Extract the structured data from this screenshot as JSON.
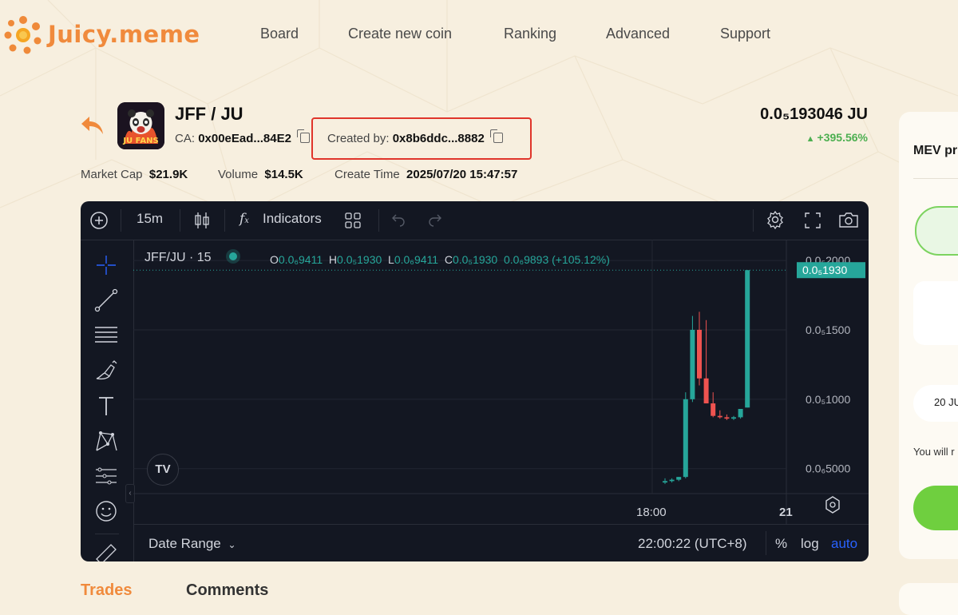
{
  "brand": {
    "name": "Juicy.meme"
  },
  "nav": {
    "items": [
      "Board",
      "Create new coin",
      "Ranking",
      "Advanced",
      "Support"
    ]
  },
  "token": {
    "pair": "JFF / JU",
    "image_text": "JU FANS",
    "ca_label": "CA:",
    "ca_value": "0x00eEad...84E2",
    "created_label": "Created by:",
    "created_value": "0x8b6ddc...8882",
    "price": "0.0₅193046 JU",
    "change": "+395.56%",
    "market_cap_label": "Market Cap",
    "market_cap_value": "$21.9K",
    "volume_label": "Volume",
    "volume_value": "$14.5K",
    "create_time_label": "Create Time",
    "create_time_value": "2025/07/20 15:47:57"
  },
  "chart_toolbar": {
    "interval": "15m",
    "indicators_label": "Indicators"
  },
  "chart": {
    "symbol_title": "JFF/JU · 15",
    "ohlc": {
      "o_label": "O",
      "o_value": "0.0₆9411",
      "h_label": "H",
      "h_value": "0.0₅1930",
      "l_label": "L",
      "l_value": "0.0₆9411",
      "c_label": "C",
      "c_value": "0.0₅1930",
      "change_value": "0.0₆9893 (+105.12%)"
    },
    "last_price_tag": "0.0₅1930",
    "watermark": "TV",
    "date_range_label": "Date Range",
    "clock": "22:00:22 (UTC+8)",
    "pct_label": "%",
    "log_label": "log",
    "auto_label": "auto"
  },
  "chart_data": {
    "type": "candlestick",
    "y_tick_labels": [
      "0.0₅2000",
      "0.0₅1500",
      "0.0₅1000",
      "0.0₆5000"
    ],
    "y_tick_values": [
      2e-05,
      1.5e-05,
      1e-05,
      5e-06
    ],
    "x_tick_labels": [
      "18:00",
      "21"
    ],
    "ylim": [
      3.2e-06,
      2.15e-05
    ],
    "candles": [
      {
        "o": 4e-06,
        "h": 4.3e-06,
        "l": 3.9e-06,
        "c": 4.1e-06
      },
      {
        "o": 4.1e-06,
        "h": 4.3e-06,
        "l": 4e-06,
        "c": 4.2e-06
      },
      {
        "o": 4.2e-06,
        "h": 4.4e-06,
        "l": 4.1e-06,
        "c": 4.4e-06
      },
      {
        "o": 4.4e-06,
        "h": 1.05e-05,
        "l": 4.3e-06,
        "c": 1e-05
      },
      {
        "o": 1e-05,
        "h": 1.6e-05,
        "l": 9.8e-06,
        "c": 1.5e-05
      },
      {
        "o": 1.5e-05,
        "h": 1.63e-05,
        "l": 1.1e-05,
        "c": 1.15e-05
      },
      {
        "o": 1.15e-05,
        "h": 1.57e-05,
        "l": 9.7e-06,
        "c": 9.7e-06
      },
      {
        "o": 9.7e-06,
        "h": 1.05e-05,
        "l": 8.7e-06,
        "c": 8.8e-06
      },
      {
        "o": 8.8e-06,
        "h": 9.2e-06,
        "l": 8.6e-06,
        "c": 8.7e-06
      },
      {
        "o": 8.7e-06,
        "h": 8.9e-06,
        "l": 8.5e-06,
        "c": 8.6e-06
      },
      {
        "o": 8.6e-06,
        "h": 8.8e-06,
        "l": 8.5e-06,
        "c": 8.7e-06
      },
      {
        "o": 8.7e-06,
        "h": 9.3e-06,
        "l": 8.6e-06,
        "c": 9.3e-06
      },
      {
        "o": 9.4e-06,
        "h": 1.93e-05,
        "l": 9.4e-06,
        "c": 1.93e-05
      }
    ],
    "colors": {
      "up": "#26a69a",
      "down": "#ef5350"
    }
  },
  "tabs": {
    "trades": "Trades",
    "comments": "Comments"
  },
  "right_panel": {
    "title": "MEV pr",
    "date_text": "20 JU",
    "note": "You will r"
  },
  "colors": {
    "accent": "#f08a3c",
    "up": "#26a69a",
    "down": "#ef5350",
    "highlight_box": "#e0352b"
  }
}
